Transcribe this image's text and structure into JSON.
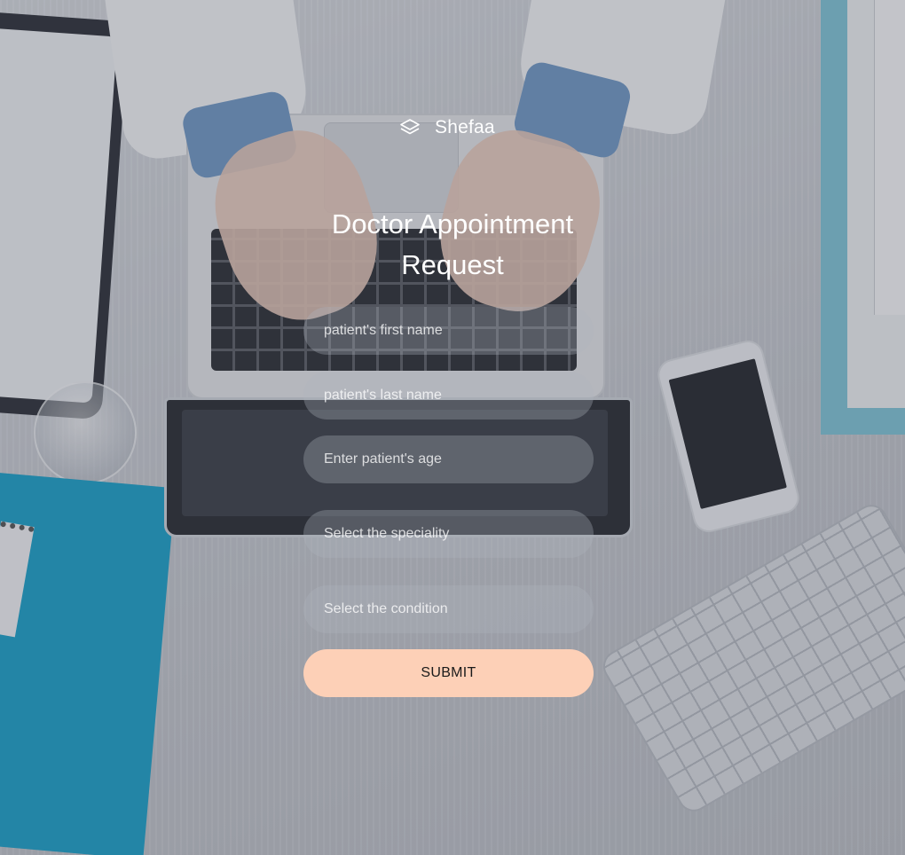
{
  "brand": {
    "icon": "layers-icon",
    "name": "Shefaa"
  },
  "form": {
    "title": "Doctor Appointment Request",
    "first_name_placeholder": "patient's first name",
    "last_name_placeholder": "patient's last name",
    "age_placeholder": "Enter patient's age",
    "speciality_label": "Select the speciality",
    "condition_label": "Select the condition",
    "submit_label": "SUBMIT"
  },
  "colors": {
    "submit_bg": "#fdd0b7",
    "field_bg": "rgba(175,180,190,0.32)",
    "text": "#ffffff"
  }
}
